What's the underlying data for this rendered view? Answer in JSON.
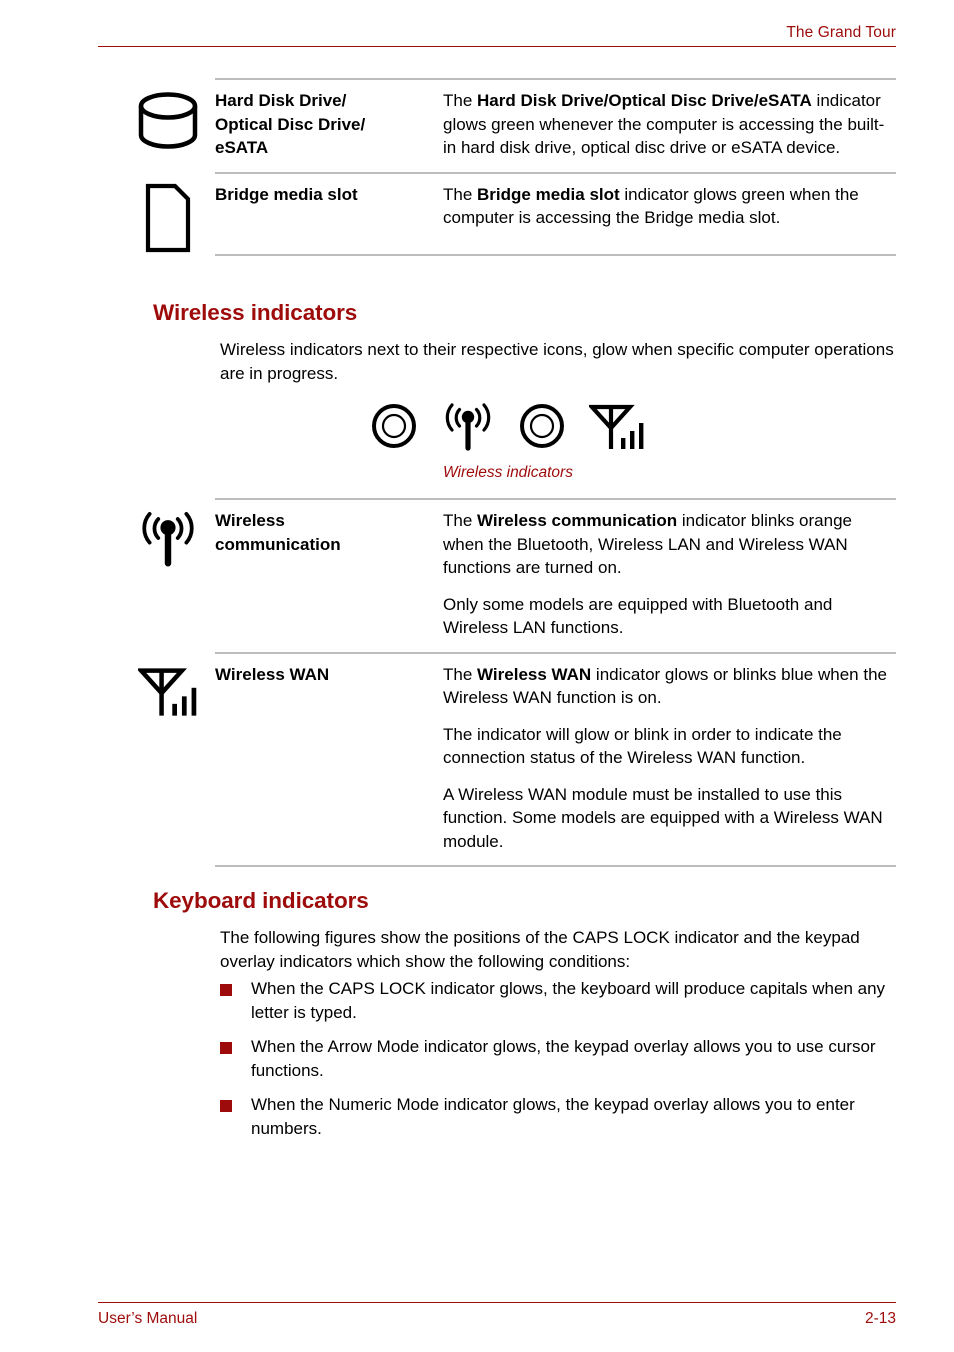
{
  "header": {
    "title": "The Grand Tour"
  },
  "footer": {
    "manual_label": "User’s Manual",
    "page_number": "2-13"
  },
  "colors": {
    "heading_red": "#9E0B0B",
    "rule_gray": "#BDBDBD",
    "text_black": "#000000"
  },
  "top_table": {
    "rows": [
      {
        "icon": "hard-disk-drive-icon",
        "name": "Hard Disk Drive/\nOptical Disc Drive/\neSATA",
        "name_line1": "Hard Disk Drive/",
        "name_line2": "Optical Disc Drive/",
        "name_line3": "eSATA",
        "paragraphs": [
          {
            "pre": "The ",
            "bold": "Hard Disk Drive/Optical Disc Drive/eSATA",
            "post": " indicator glows green whenever the computer is accessing the built-in hard disk drive, optical disc drive or eSATA device."
          }
        ]
      },
      {
        "icon": "bridge-media-slot-icon",
        "name": "Bridge media slot",
        "paragraphs": [
          {
            "pre": "The ",
            "bold": "Bridge media slot",
            "post": " indicator glows green when the computer is accessing the Bridge media slot."
          }
        ]
      }
    ]
  },
  "wireless_section": {
    "heading": "Wireless indicators",
    "intro": "Wireless indicators next to their respective icons, glow when specific computer operations are in progress.",
    "figure": {
      "caption": "Wireless indicators",
      "icons": [
        "led-indicator-icon",
        "wireless-communication-icon",
        "led-indicator-icon",
        "wireless-wan-icon"
      ]
    },
    "table": {
      "rows": [
        {
          "icon": "wireless-communication-icon",
          "name": "Wireless communication",
          "name_line1": "Wireless",
          "name_line2": "communication",
          "paragraphs": [
            {
              "pre": "The ",
              "bold": "Wireless communication",
              "post": " indicator blinks orange when the Bluetooth, Wireless LAN and Wireless WAN functions are turned on."
            },
            {
              "pre": "Only some models are equipped with Bluetooth and Wireless LAN functions.",
              "bold": "",
              "post": ""
            }
          ]
        },
        {
          "icon": "wireless-wan-icon",
          "name": "Wireless WAN",
          "paragraphs": [
            {
              "pre": "The ",
              "bold": "Wireless WAN",
              "post": " indicator glows or blinks blue when the Wireless WAN function is on."
            },
            {
              "pre": "The indicator will glow or blink in order to indicate the connection status of the Wireless WAN function.",
              "bold": "",
              "post": ""
            },
            {
              "pre": "A Wireless WAN module must be installed to use this function. Some models are equipped with a Wireless WAN module.",
              "bold": "",
              "post": ""
            }
          ]
        }
      ]
    }
  },
  "keyboard_section": {
    "heading": "Keyboard indicators",
    "intro": "The following figures show the positions of the CAPS LOCK indicator and the keypad overlay indicators which show the following conditions:",
    "bullets": [
      "When the CAPS LOCK indicator glows, the keyboard will produce capitals when any letter is typed.",
      "When the Arrow Mode indicator glows, the keypad overlay allows you to use cursor functions.",
      "When the Numeric Mode indicator glows, the keypad overlay allows you to enter numbers."
    ]
  }
}
